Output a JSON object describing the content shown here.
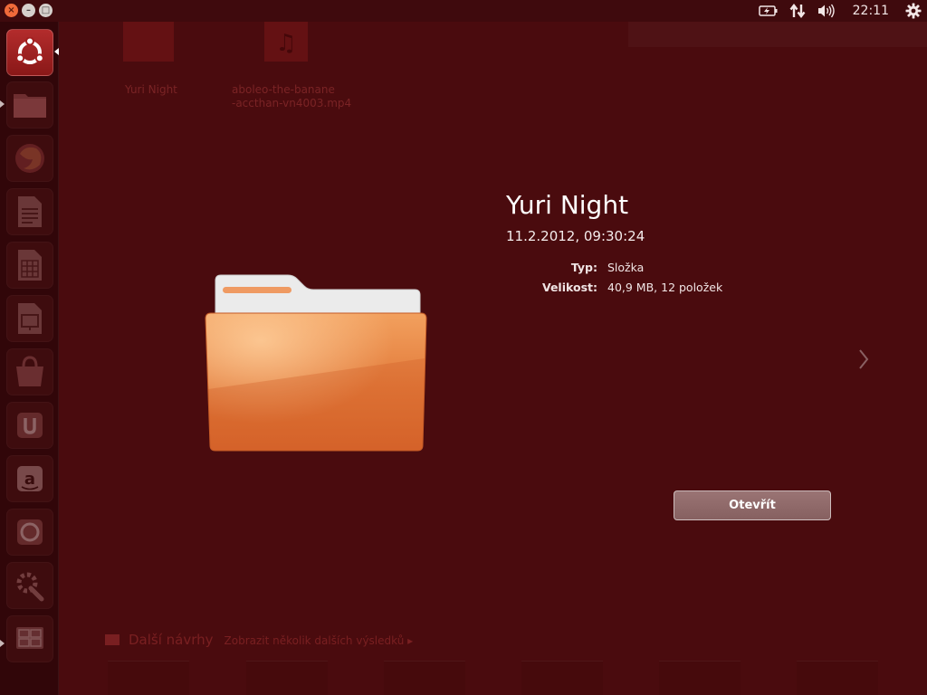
{
  "panel": {
    "clock": "22:11",
    "indicators": [
      "battery-icon",
      "network-icon",
      "volume-icon",
      "session-gear-icon"
    ]
  },
  "launcher": {
    "items": [
      "ubuntu-dash-icon",
      "home-folder-icon",
      "firefox-icon",
      "libreoffice-writer-icon",
      "libreoffice-calc-icon",
      "libreoffice-impress-icon",
      "software-center-icon",
      "ubuntu-one-icon",
      "amazon-icon",
      "ubuntu-one-music-icon",
      "system-settings-icon",
      "workspace-switcher-icon"
    ]
  },
  "background": {
    "results": [
      {
        "caption_lines": [
          "Yuri Night"
        ]
      },
      {
        "caption_lines": [
          "aboleo-the-banane",
          "-accthan-vn4003.mp4"
        ]
      }
    ],
    "category_label": "Další návrhy",
    "category_sub": "Zobrazit několik dalších výsledků ▸"
  },
  "preview": {
    "title": "Yuri Night",
    "date": "11.2.2012, 09:30:24",
    "info": [
      {
        "label": "Typ:",
        "value": "Složka"
      },
      {
        "label": "Velikost:",
        "value": "40,9 MB, 12 položek"
      }
    ],
    "open_button": "Otevřít"
  },
  "colors": {
    "background": "#4a0b0e",
    "folder_body": "#e87a3e",
    "button": "#8f6a6a"
  }
}
